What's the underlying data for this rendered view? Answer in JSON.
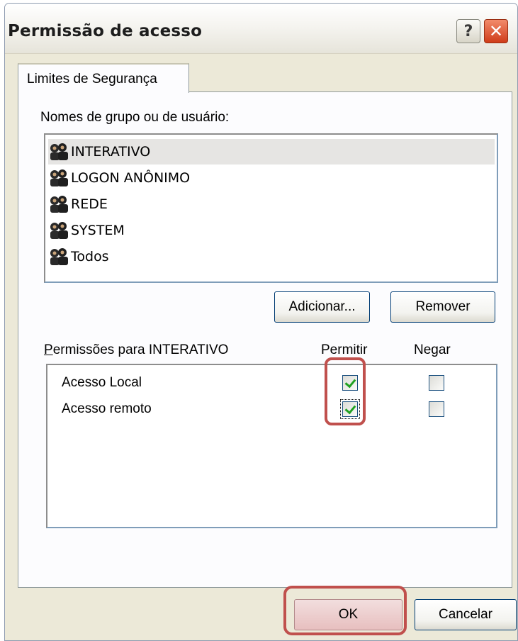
{
  "window": {
    "title": "Permissão de acesso",
    "help_glyph": "?",
    "close_glyph": "✕"
  },
  "tabs": [
    {
      "label": "Limites de Segurança",
      "active": true
    }
  ],
  "groups": {
    "label": "Nomes de grupo ou de usuário:",
    "items": [
      {
        "name": "INTERATIVO",
        "icon": "user-group-icon",
        "selected": true
      },
      {
        "name": "LOGON ANÔNIMO",
        "icon": "user-group-icon"
      },
      {
        "name": "REDE",
        "icon": "user-group-icon"
      },
      {
        "name": "SYSTEM",
        "icon": "user-group-icon"
      },
      {
        "name": "Todos",
        "icon": "user-group-icon"
      }
    ],
    "add_label": "Adicionar...",
    "remove_label": "Remover"
  },
  "permissions": {
    "label": "Permissões para INTERATIVO",
    "allow_header": "Permitir",
    "deny_header": "Negar",
    "rows": [
      {
        "name": "Acesso Local",
        "allow": true,
        "deny": false
      },
      {
        "name": "Acesso remoto",
        "allow": true,
        "deny": false
      }
    ]
  },
  "footer": {
    "ok_label": "OK",
    "cancel_label": "Cancelar"
  },
  "colors": {
    "highlight": "#c0504d",
    "title_bar": "#f4f3ee",
    "dialog": "#ece9d8",
    "close": "#cf3c1a"
  }
}
